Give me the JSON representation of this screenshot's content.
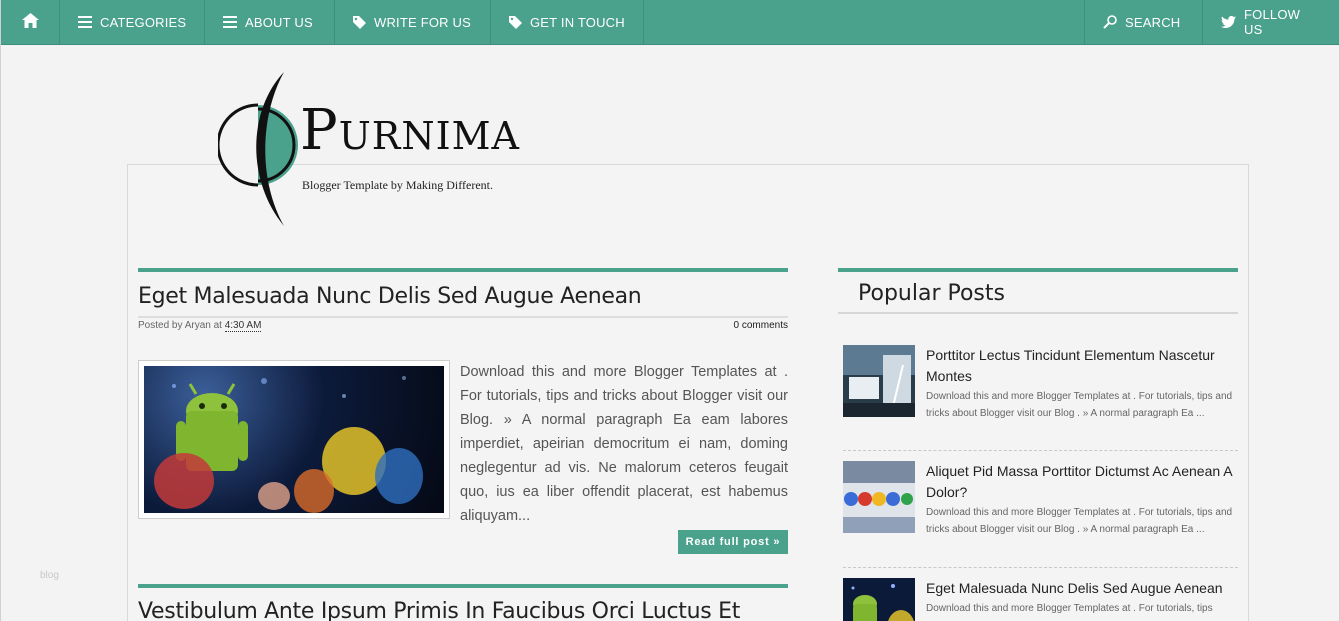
{
  "nav": {
    "home_icon": "home-icon",
    "items": [
      {
        "label": "CATEGORIES",
        "icon": "menu-icon"
      },
      {
        "label": "ABOUT US",
        "icon": "menu-icon"
      },
      {
        "label": "WRITE FOR US",
        "icon": "tag-icon"
      },
      {
        "label": "GET IN TOUCH",
        "icon": "tag-icon"
      }
    ],
    "search_label": "SEARCH",
    "follow_label": "FOLLOW US"
  },
  "logo": {
    "first_letter": "P",
    "rest": "URNIMA",
    "tagline": "Blogger Template by Making Different."
  },
  "posts": [
    {
      "title": "Eget Malesuada Nunc Delis Sed Augue Aenean",
      "meta_prefix": "Posted by Aryan at ",
      "time": "4:30 AM",
      "comments": "0 comments",
      "excerpt": "Download this and more Blogger Templates at . For tutorials, tips and tricks about Blogger visit our Blog. » A normal paragraph Ea eam labores imperdiet, apeirian democritum ei nam, doming neglegentur ad vis. Ne malorum ceteros feugait quo, ius ea liber offendit placerat, est habemus aliquyam...",
      "read_more": "Read full post »"
    },
    {
      "title": "Vestibulum Ante Ipsum Primis In Faucibus Orci Luctus Et"
    }
  ],
  "side_note": "blog",
  "sidebar": {
    "widget_title": "Popular Posts",
    "items": [
      {
        "title": "Porttitor Lectus Tincidunt Elementum Nascetur Montes",
        "desc": "Download this and more Blogger Templates at . For tutorials, tips and tricks about Blogger visit our Blog . » A normal paragraph Ea ..."
      },
      {
        "title": "Aliquet Pid Massa Porttitor Dictumst Ac Aenean A Dolor?",
        "desc": "Download this and more Blogger Templates at . For tutorials, tips and tricks about Blogger visit our Blog . » A normal paragraph Ea ..."
      },
      {
        "title": "Eget Malesuada Nunc Delis Sed Augue Aenean",
        "desc": "Download this and more Blogger Templates at . For tutorials, tips"
      }
    ]
  },
  "colors": {
    "accent": "#4aa18c",
    "background": "#f3f3f3"
  }
}
